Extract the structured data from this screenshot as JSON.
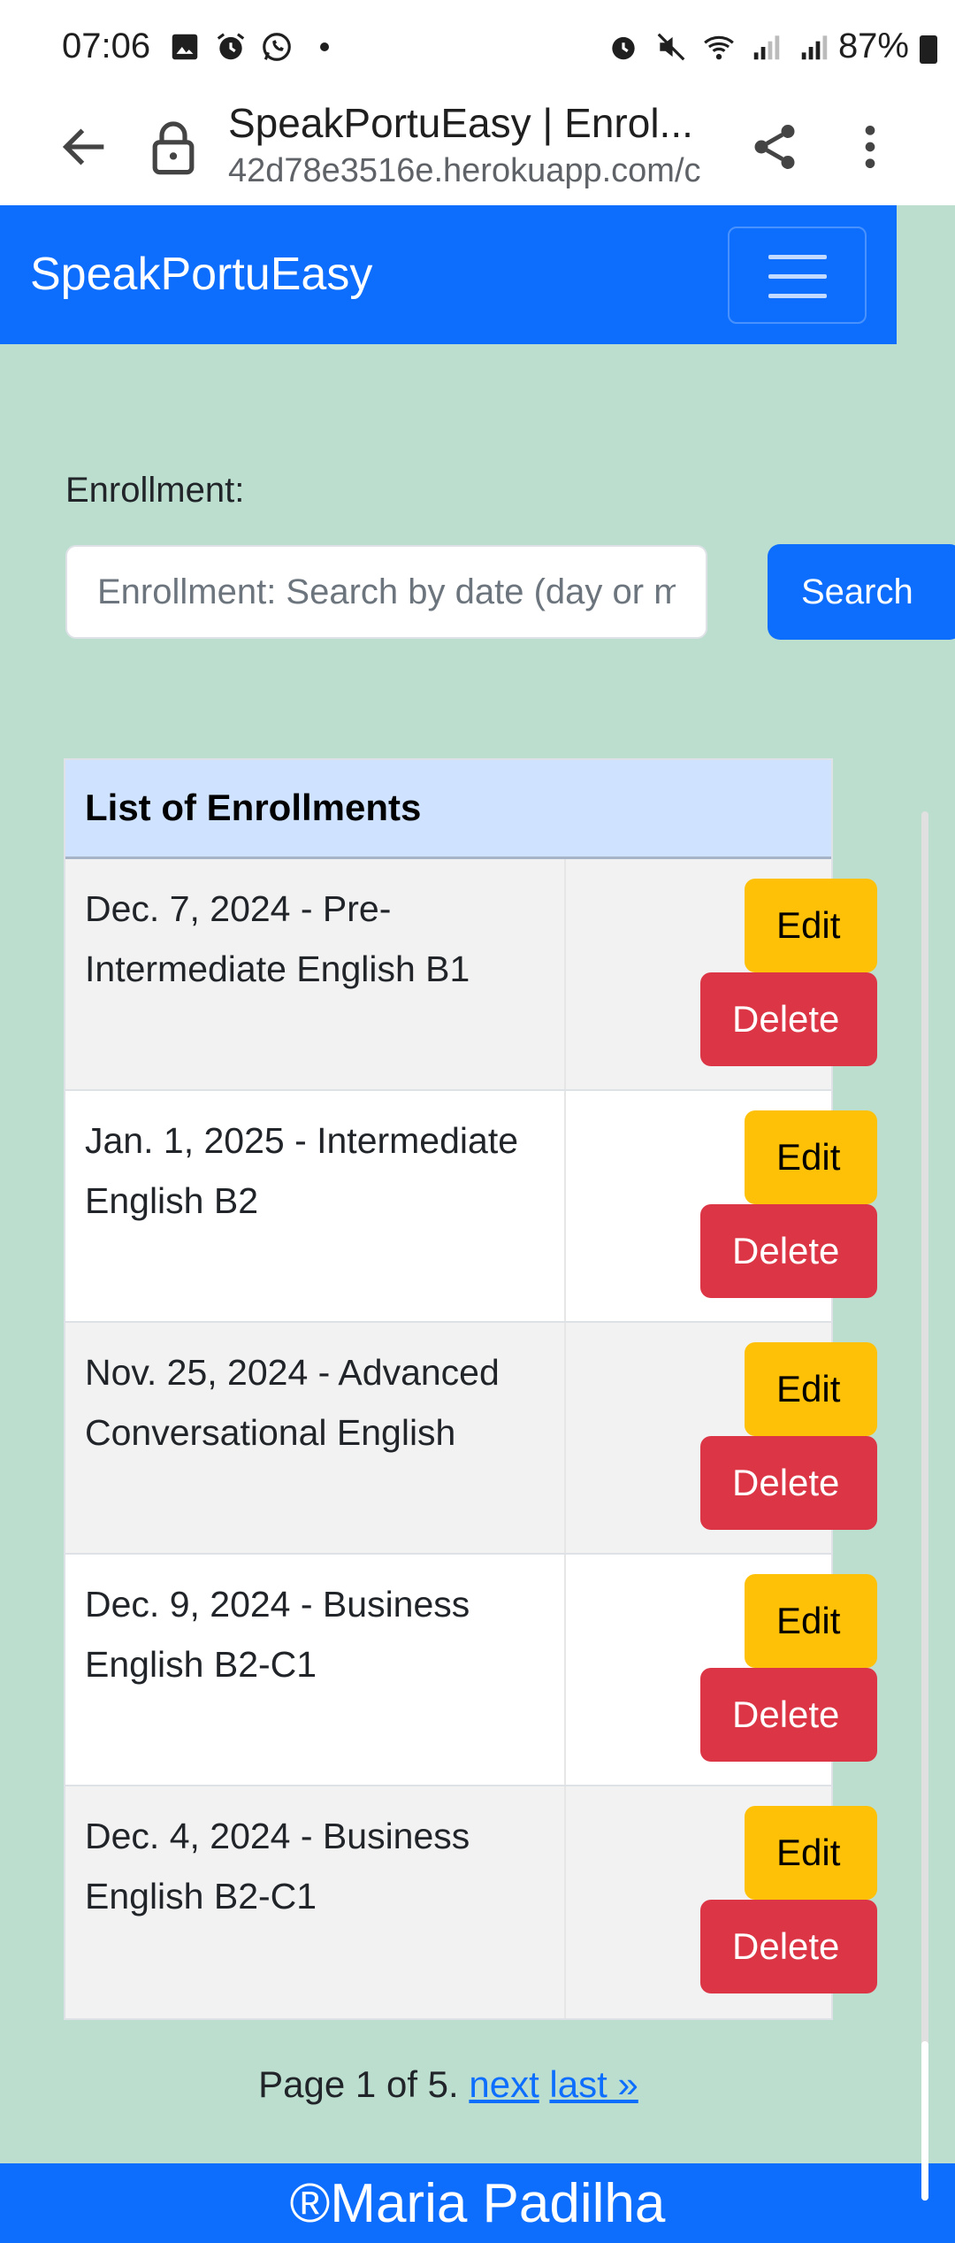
{
  "status_bar": {
    "time": "07:06",
    "battery": "87%",
    "icons_left": [
      "image-icon",
      "alarm-icon",
      "whatsapp-icon",
      "dot"
    ],
    "icons_right": [
      "alarm-icon",
      "mute-icon",
      "wifi-icon",
      "signal-icon",
      "signal-icon",
      "battery-icon"
    ]
  },
  "browser": {
    "title": "SpeakPortuEasy | Enrol...",
    "host": "42d78e3516e.herokuapp.com/c"
  },
  "navbar": {
    "brand": "SpeakPortuEasy"
  },
  "search": {
    "label": "Enrollment:",
    "placeholder": "Enrollment: Search by date (day or month)",
    "button": "Search"
  },
  "list": {
    "header": "List of Enrollments",
    "edit_label": "Edit",
    "delete_label": "Delete",
    "rows": [
      {
        "text": "Dec. 7, 2024 - Pre-Intermediate English B1"
      },
      {
        "text": "Jan. 1, 2025 - Intermediate English B2"
      },
      {
        "text": "Nov. 25, 2024 - Advanced Conversational English"
      },
      {
        "text": "Dec. 9, 2024 - Business English B2-C1"
      },
      {
        "text": "Dec. 4, 2024 - Business English B2-C1"
      }
    ]
  },
  "pagination": {
    "text": "Page 1 of 5.",
    "next": "next",
    "last": "last »"
  },
  "footer": {
    "text": "®Maria Padilha"
  },
  "colors": {
    "primary": "#0d6efd",
    "page_bg": "#bcdecf",
    "header_bg": "#cfe2ff",
    "edit": "#ffc107",
    "delete": "#dc3545"
  }
}
